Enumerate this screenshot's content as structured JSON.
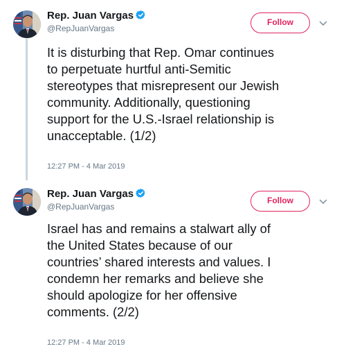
{
  "thread": {
    "tweets": [
      {
        "author": {
          "display_name": "Rep. Juan Vargas",
          "handle": "@RepJuanVargas",
          "verified": true
        },
        "follow_label": "Follow",
        "text": "It is disturbing that Rep. Omar continues\nto perpetuate hurtful anti-Semitic\nstereotypes that misrepresent our Jewish\ncommunity. Additionally, questioning\nsupport for the U.S.-Israel relationship is\nunacceptable. (1/2)",
        "timestamp": "12:27 PM - 4 Mar 2019"
      },
      {
        "author": {
          "display_name": "Rep. Juan Vargas",
          "handle": "@RepJuanVargas",
          "verified": true
        },
        "follow_label": "Follow",
        "text": "Israel has and remains a stalwart ally of\nthe United States because of our\ncountries’ shared interests and values. I\ncondemn her remarks and believe she\nshould apologize for her offensive\ncomments. (2/2)",
        "timestamp": "12:27 PM - 4 Mar 2019"
      }
    ]
  },
  "icons": {
    "verified": "verified-badge-icon",
    "menu": "chevron-down-icon",
    "avatar": "profile-photo"
  },
  "colors": {
    "follow_accent": "#e0245e",
    "verified_blue": "#1da1f2",
    "secondary_text": "#657786",
    "primary_text": "#14171a",
    "thread_line": "#ccd6dd"
  }
}
